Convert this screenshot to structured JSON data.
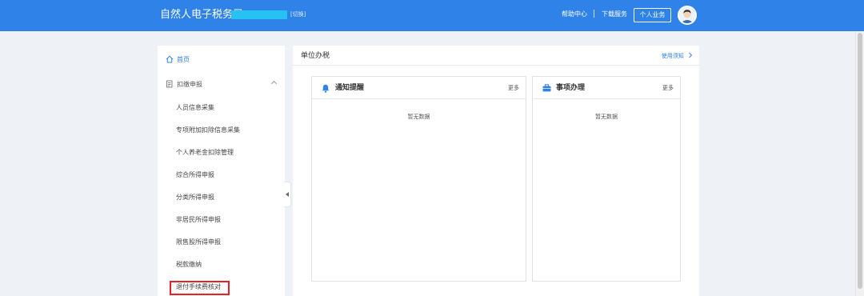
{
  "header": {
    "title": "自然人电子税务局",
    "switch_label": "[切换]",
    "help_label": "帮助中心",
    "download_label": "下载服务",
    "personal_label": "个人业务",
    "colors": {
      "bar": "#2f82e8",
      "org_mask": "#27c1f4"
    }
  },
  "sidebar": {
    "home_label": "首页",
    "group_label": "扣缴申报",
    "items": [
      "人员信息采集",
      "专项附加扣除信息采集",
      "个人养老金扣除管理",
      "综合所得申报",
      "分类所得申报",
      "非居民所得申报",
      "限售股所得申报",
      "税款缴纳",
      "退付手续费核对"
    ],
    "highlighted_item": "退付手续费核对",
    "highlight_color": "#e8202a"
  },
  "main": {
    "title": "单位办税",
    "usage_label": "使用须知",
    "cards": {
      "notify": {
        "title": "通知提醒",
        "more": "更多",
        "empty": "暂无数据",
        "icon": "bell-icon"
      },
      "matter": {
        "title": "事项办理",
        "more": "更多",
        "empty": "暂无数据",
        "icon": "briefcase-icon"
      }
    }
  }
}
